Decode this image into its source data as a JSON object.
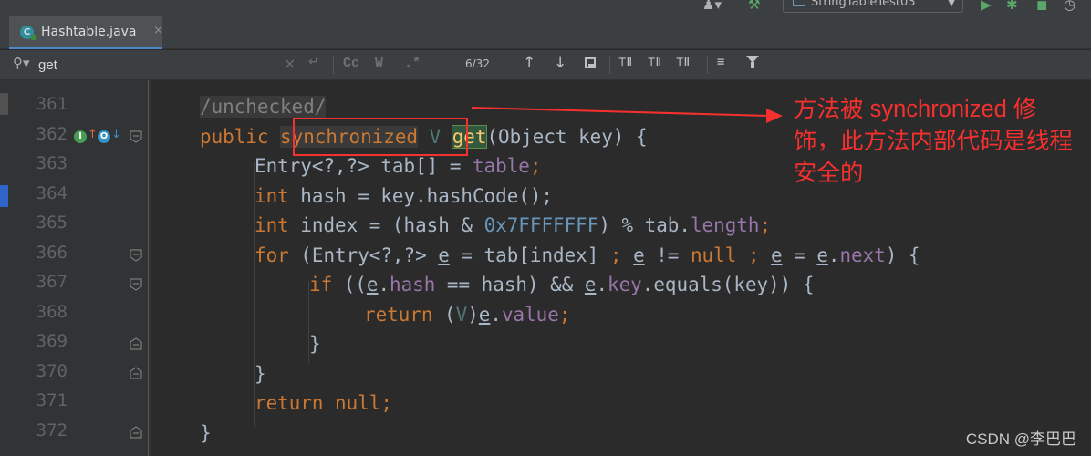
{
  "toolbar": {
    "run_config_label": "StringTableTest03",
    "icons": [
      "user-icon",
      "build-hammer-icon",
      "run-config-icon",
      "run-icon",
      "debug-icon",
      "coverage-icon",
      "profile-icon"
    ]
  },
  "tab": {
    "file_name": "Hashtable.java",
    "file_icon_letter": "C",
    "close_glyph": "×"
  },
  "search": {
    "query": "get",
    "match_case_label": "Cc",
    "words_label": "W",
    "regex_label": ".*",
    "match_count": "6/32"
  },
  "editor": {
    "line_numbers": [
      "361",
      "362",
      "363",
      "364",
      "365",
      "366",
      "367",
      "368",
      "369",
      "370",
      "371",
      "372"
    ],
    "gutter_markers": {
      "override_letter": "I",
      "implements_letter": "O"
    },
    "code": {
      "l361": "/unchecked/",
      "l362": {
        "kw": "public",
        "sync": "synchronized",
        "tparam": "V",
        "method": "get",
        "rest": "(Object key) {"
      },
      "l363": {
        "a": "Entry<?,?> tab[] = ",
        "field": "table",
        "end": ";"
      },
      "l364": {
        "kw": "int",
        "rest": " hash = key.hashCode();"
      },
      "l365": {
        "kw": "int",
        "a": " index = (hash & ",
        "num": "0x7FFFFFFF",
        "b": ") % tab.",
        "field": "length",
        "end": ";"
      },
      "l366": {
        "kw": "for",
        "a": " (Entry<?,?> ",
        "e1": "e",
        "b": " = tab[index] ",
        "semi1": ";",
        "sp1": " ",
        "e2": "e",
        "c": " != ",
        "null": "null",
        "sp2": " ",
        "semi2": ";",
        "sp3": " ",
        "e3": "e",
        "d": " = ",
        "e4": "e",
        "dot": ".",
        "field": "next",
        "end": ") {"
      },
      "l367": {
        "kw": "if",
        "a": " ((",
        "e1": "e",
        "dot1": ".",
        "f1": "hash",
        "b": " == hash) && ",
        "e2": "e",
        "dot2": ".",
        "f2": "key",
        "end": ".equals(key)) {"
      },
      "l368": {
        "kw": "return",
        "a": " (",
        "tp": "V",
        "b": ")",
        "e": "e",
        "dot": ".",
        "field": "value",
        "end": ";"
      },
      "l369": "}",
      "l370": "}",
      "l371": {
        "kw": "return",
        "sp": " ",
        "null": "null",
        "end": ";"
      },
      "l372": "}"
    }
  },
  "annotation": {
    "note": "方法被 synchronized 修饰，此方法内部代码是线程安全的",
    "color": "#f5302e"
  },
  "watermark": "CSDN @李巴巴",
  "colors": {
    "keyword": "#cc7832",
    "field": "#9876aa",
    "number": "#6897bb",
    "comment": "#808080",
    "text": "#a9b7c6",
    "method_highlight": "#32593d",
    "tab_accent": "#4a88c7"
  }
}
